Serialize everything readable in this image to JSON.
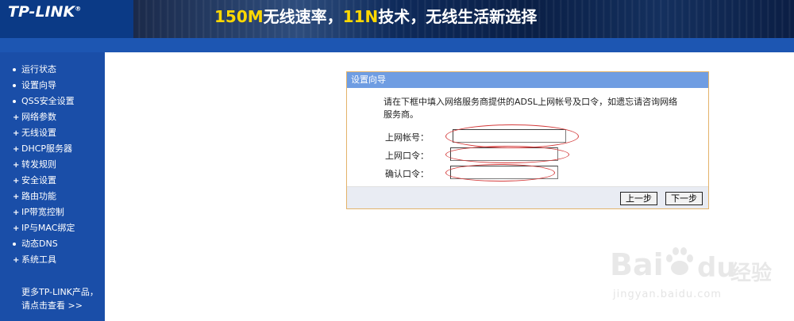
{
  "header": {
    "logo": "TP-LINK",
    "logo_reg": "®",
    "banner_part1": "150M",
    "banner_part2": "无线速率，",
    "banner_part3": "11N",
    "banner_part4": "技术，无线生活新选择"
  },
  "sidebar": {
    "items": [
      {
        "label": "运行状态",
        "marker": "dot"
      },
      {
        "label": "设置向导",
        "marker": "dot"
      },
      {
        "label": "QSS安全设置",
        "marker": "dot"
      },
      {
        "label": "网络参数",
        "marker": "plus"
      },
      {
        "label": "无线设置",
        "marker": "plus"
      },
      {
        "label": "DHCP服务器",
        "marker": "plus"
      },
      {
        "label": "转发规则",
        "marker": "plus"
      },
      {
        "label": "安全设置",
        "marker": "plus"
      },
      {
        "label": "路由功能",
        "marker": "plus"
      },
      {
        "label": "IP带宽控制",
        "marker": "plus"
      },
      {
        "label": "IP与MAC绑定",
        "marker": "plus"
      },
      {
        "label": "动态DNS",
        "marker": "dot"
      },
      {
        "label": "系统工具",
        "marker": "plus"
      }
    ],
    "more_line1": "更多TP-LINK产品，",
    "more_line2": "请点击查看 >>"
  },
  "wizard": {
    "title": "设置向导",
    "intro": "请在下框中填入网络服务商提供的ADSL上网帐号及口令，如遗忘请咨询网络服务商。",
    "account_label": "上网帐号：",
    "account_value": "",
    "password_label": "上网口令：",
    "password_value": "",
    "confirm_label": "确认口令：",
    "confirm_value": "",
    "prev_button": "上一步",
    "next_button": "下一步"
  },
  "watermark": {
    "brand": "Bai",
    "suffix": "经验",
    "url": "jingyan.baidu.com"
  },
  "colors": {
    "header_blue": "#0d3e8e",
    "sidebar_blue": "#1a4ea8",
    "title_bar": "#6f9de2",
    "highlight_yellow": "#ffd800",
    "annotation_red": "#d43b3b"
  }
}
